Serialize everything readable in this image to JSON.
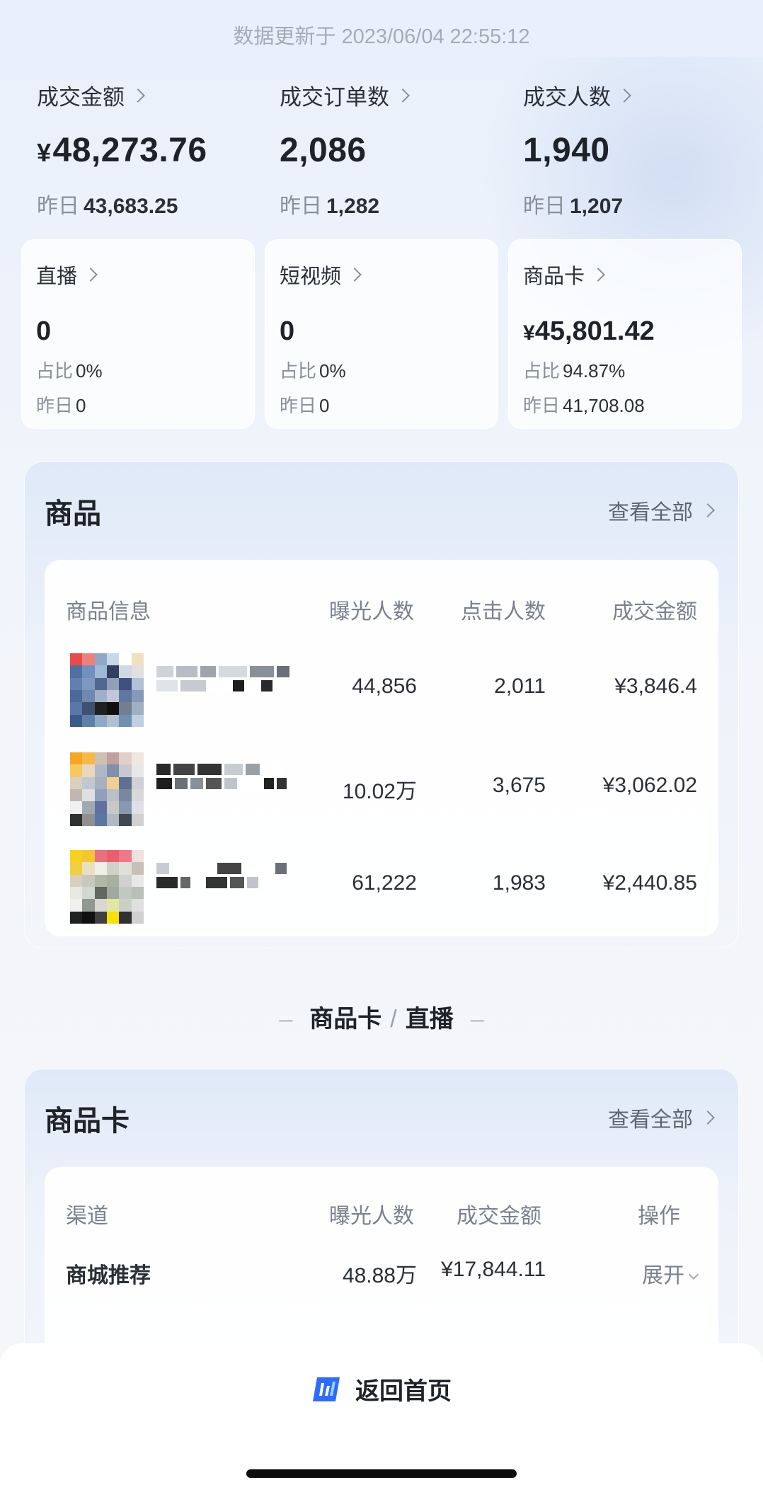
{
  "update_time": "数据更新于 2023/06/04 22:55:12",
  "metrics": [
    {
      "label": "成交金额",
      "currency": "¥",
      "value": "48,273.76",
      "yesterday_label": "昨日",
      "yesterday_value": "43,683.25"
    },
    {
      "label": "成交订单数",
      "currency": "",
      "value": "2,086",
      "yesterday_label": "昨日",
      "yesterday_value": "1,282"
    },
    {
      "label": "成交人数",
      "currency": "",
      "value": "1,940",
      "yesterday_label": "昨日",
      "yesterday_value": "1,207"
    }
  ],
  "channels": [
    {
      "label": "直播",
      "currency": "",
      "value": "0",
      "share_label": "占比",
      "share": "0%",
      "yesterday_label": "昨日",
      "yesterday": "0"
    },
    {
      "label": "短视频",
      "currency": "",
      "value": "0",
      "share_label": "占比",
      "share": "0%",
      "yesterday_label": "昨日",
      "yesterday": "0"
    },
    {
      "label": "商品卡",
      "currency": "¥",
      "value": "45,801.42",
      "share_label": "占比",
      "share": "94.87%",
      "yesterday_label": "昨日",
      "yesterday": "41,708.08"
    }
  ],
  "products_panel": {
    "title": "商品",
    "view_all": "查看全部",
    "headers": [
      "商品信息",
      "曝光人数",
      "点击人数",
      "成交金额"
    ],
    "rows": [
      {
        "exposure": "44,856",
        "clicks": "2,011",
        "amount": "¥3,846.4"
      },
      {
        "exposure": "10.02万",
        "clicks": "3,675",
        "amount": "¥3,062.02"
      },
      {
        "exposure": "61,222",
        "clicks": "1,983",
        "amount": "¥2,440.85"
      }
    ]
  },
  "section_divider": {
    "left": "商品卡",
    "sep": "/",
    "right": "直播"
  },
  "card_panel": {
    "title": "商品卡",
    "view_all": "查看全部",
    "headers": [
      "渠道",
      "曝光人数",
      "成交金额",
      "操作"
    ],
    "rows": [
      {
        "channel": "商城推荐",
        "exposure": "48.88万",
        "amount": "¥17,844.11",
        "action": "展开"
      }
    ]
  },
  "bottom": {
    "home_label": "返回首页"
  },
  "colors": {
    "accent": "#2f6bff",
    "text": "#1f2329",
    "muted": "#8a909a"
  }
}
